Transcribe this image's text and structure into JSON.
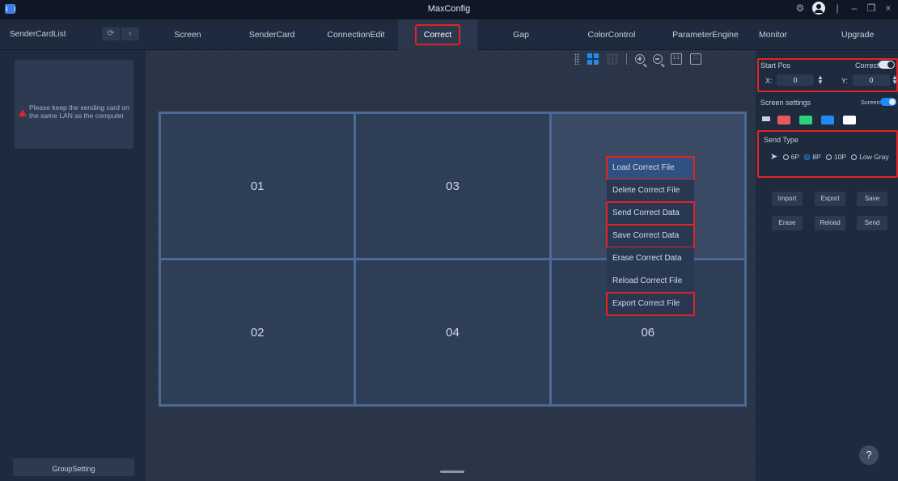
{
  "window": {
    "title": "MaxConfig",
    "controls": [
      "gear-icon",
      "user-icon",
      "minimize-icon",
      "restore-icon",
      "close-icon"
    ]
  },
  "sidebar": {
    "title": "SenderCardList",
    "refresh_icon": "refresh-icon",
    "collapse_icon": "chevron-left-icon",
    "warning_text": "Please keep the sending card on the same LAN as the computer",
    "group_setting": "GroupSetting"
  },
  "nav": {
    "tabs": [
      {
        "label": "Screen"
      },
      {
        "label": "SenderCard"
      },
      {
        "label": "ConnectionEdit"
      },
      {
        "label": "Correct",
        "active": true
      },
      {
        "label": "Gap"
      },
      {
        "label": "ColorControl"
      },
      {
        "label": "ParameterEngine"
      }
    ],
    "monitor": "Monitor",
    "upgrade": "Upgrade"
  },
  "canvas": {
    "toolbar": [
      "drag-handle-icon",
      "grid-2x2-icon",
      "grid-3x3-icon",
      "zoom-in-icon",
      "zoom-out-icon",
      "actual-size-icon",
      "fit-screen-icon"
    ],
    "cells": [
      "01",
      "03",
      "",
      "02",
      "04",
      "06"
    ],
    "context_menu": [
      {
        "label": "Load Correct File",
        "highlighted": true
      },
      {
        "label": "Delete Correct File",
        "highlighted": false
      },
      {
        "label": "Send Correct Data",
        "highlighted": true
      },
      {
        "label": "Save Correct Data",
        "highlighted": true
      },
      {
        "label": "Erase Correct Data",
        "highlighted": false
      },
      {
        "label": "Reload Correct File",
        "highlighted": false
      },
      {
        "label": "Export Correct File",
        "highlighted": true
      }
    ]
  },
  "panel": {
    "start_pos": "Start Pos",
    "correct_toggle": "Correct",
    "x_label": "X:",
    "x_value": "0",
    "y_label": "Y:",
    "y_value": "0",
    "screen_settings": "Screen settings",
    "screen_toggle": "Screen",
    "swatches": [
      "#e65a5a",
      "#2fd27a",
      "#1f8cf5",
      "#ffffff"
    ],
    "send_type": "Send Type",
    "send_options": [
      "6P",
      "8P",
      "10P",
      "Low Gray"
    ],
    "send_selected": "8P",
    "actions_row1": [
      "Import",
      "Export",
      "Save"
    ],
    "actions_row2": [
      "Erase",
      "Reload",
      "Send"
    ],
    "help": "?"
  }
}
